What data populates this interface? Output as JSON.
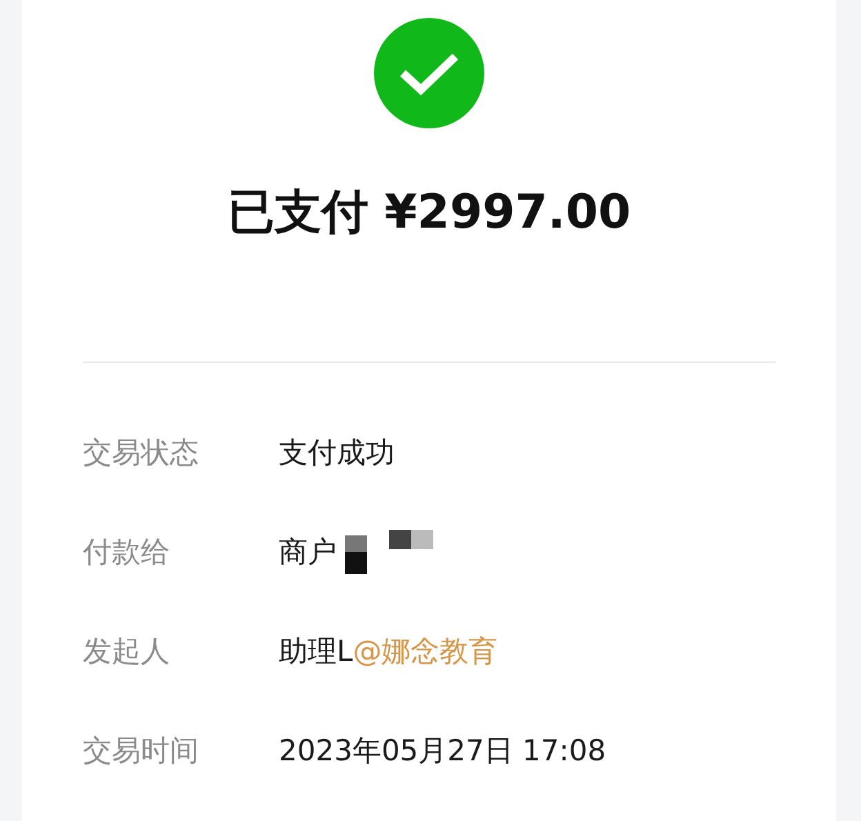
{
  "title": "已支付 ¥2997.00",
  "details": [
    {
      "label": "交易状态",
      "value": "支付成功"
    },
    {
      "label": "付款给",
      "value": "商户",
      "redacted": true
    },
    {
      "label": "发起人",
      "value": "助理L",
      "mention": "@娜念教育"
    },
    {
      "label": "交易时间",
      "value": "2023年05月27日 17:08"
    }
  ]
}
